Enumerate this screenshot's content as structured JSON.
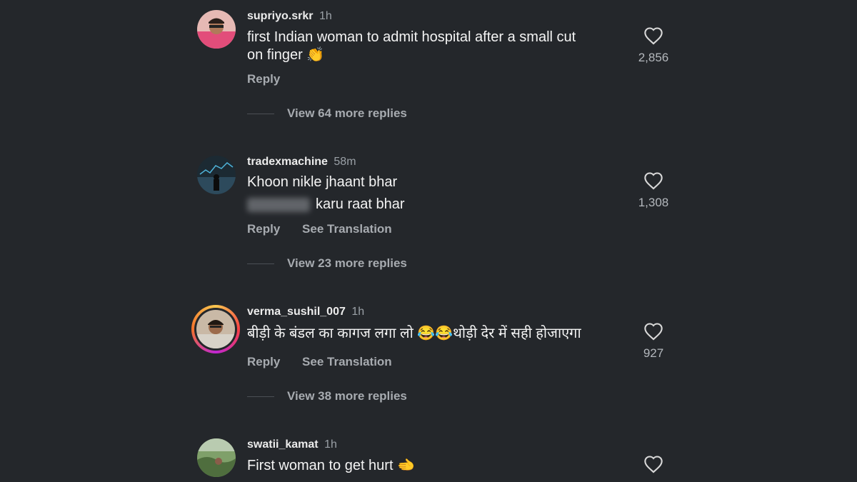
{
  "comments": [
    {
      "username": "supriyo.srkr",
      "time": "1h",
      "text_line1": "first Indian woman to admit hospital after a small cut",
      "text_line2": "on finger",
      "emoji": "👏",
      "reply": "Reply",
      "view_more": "View 64 more replies",
      "likes": "2,856"
    },
    {
      "username": "tradexmachine",
      "time": "58m",
      "text_line1": "Khoon nikle jhaant bhar",
      "text_line2": "karu raat bhar",
      "reply": "Reply",
      "see_translation": "See Translation",
      "view_more": "View 23 more replies",
      "likes": "1,308"
    },
    {
      "username": "verma_sushil_007",
      "time": "1h",
      "text_part1": "बीड़ी के बंडल का कागज लगा लो ",
      "emoji": "😂😂",
      "text_part2": "थोड़ी देर में सही होजाएगा",
      "reply": "Reply",
      "see_translation": "See Translation",
      "view_more": "View 38 more replies",
      "likes": "927"
    },
    {
      "username": "swatii_kamat",
      "time": "1h",
      "text_line1": "First woman to get hurt",
      "emoji": "🫲"
    }
  ]
}
